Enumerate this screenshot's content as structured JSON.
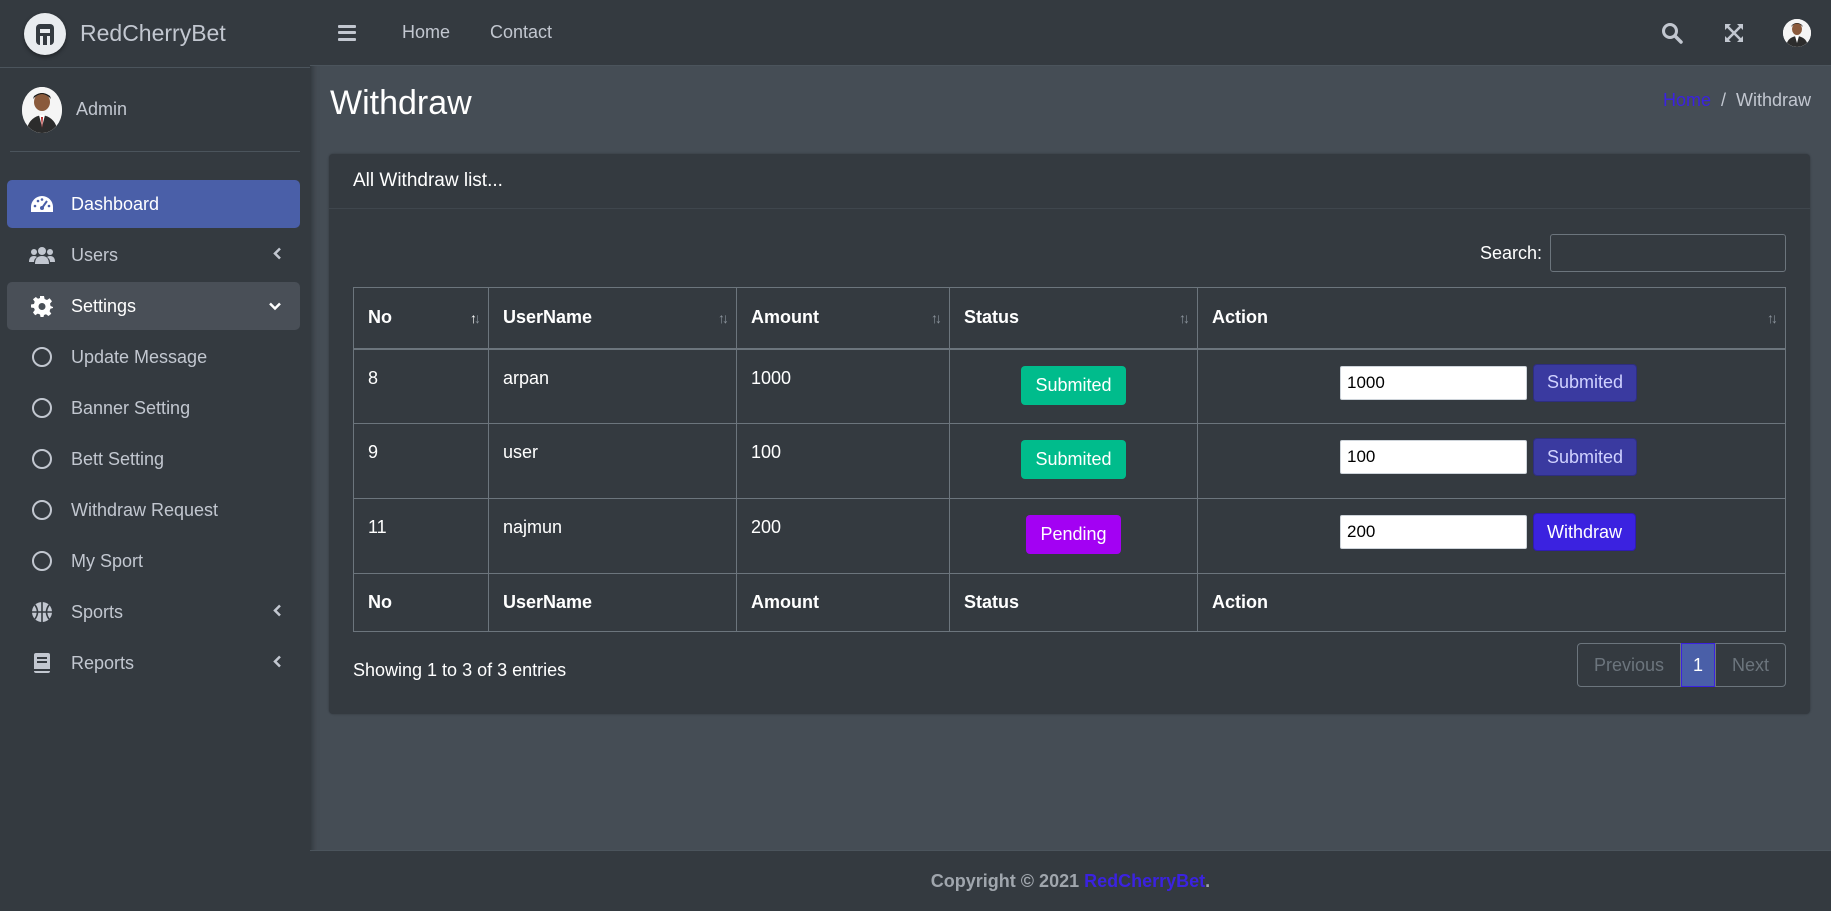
{
  "brand": {
    "name": "RedCherryBet"
  },
  "user": {
    "name": "Admin"
  },
  "sidebar": {
    "items": [
      {
        "label": "Dashboard",
        "icon": "dashboard-icon"
      },
      {
        "label": "Users",
        "icon": "users-icon"
      },
      {
        "label": "Settings",
        "icon": "gear-icon"
      },
      {
        "label": "Update Message",
        "icon": "circle-icon"
      },
      {
        "label": "Banner Setting",
        "icon": "circle-icon"
      },
      {
        "label": "Bett Setting",
        "icon": "circle-icon"
      },
      {
        "label": "Withdraw Request",
        "icon": "circle-icon"
      },
      {
        "label": "My Sport",
        "icon": "circle-icon"
      },
      {
        "label": "Sports",
        "icon": "basketball-icon"
      },
      {
        "label": "Reports",
        "icon": "book-icon"
      }
    ]
  },
  "topbar": {
    "home": "Home",
    "contact": "Contact"
  },
  "page": {
    "title": "Withdraw"
  },
  "breadcrumb": {
    "home": "Home",
    "separator": "/",
    "current": "Withdraw"
  },
  "card": {
    "title": "All Withdraw list..."
  },
  "search": {
    "label": "Search:",
    "placeholder": "",
    "value": ""
  },
  "table": {
    "headers": [
      "No",
      "UserName",
      "Amount",
      "Status",
      "Action"
    ],
    "rows": [
      {
        "no": "8",
        "username": "arpan",
        "amount": "1000",
        "status": "Submited",
        "input_value": "1000",
        "action_label": "Submited"
      },
      {
        "no": "9",
        "username": "user",
        "amount": "100",
        "status": "Submited",
        "input_value": "100",
        "action_label": "Submited"
      },
      {
        "no": "11",
        "username": "najmun",
        "amount": "200",
        "status": "Pending",
        "input_value": "200",
        "action_label": "Withdraw"
      }
    ],
    "footers": [
      "No",
      "UserName",
      "Amount",
      "Status",
      "Action"
    ]
  },
  "info": "Showing 1 to 3 of 3 entries",
  "pagination": {
    "previous": "Previous",
    "current": "1",
    "next": "Next"
  },
  "footer": {
    "text": "Copyright © 2021 ",
    "brand": "RedCherryBet",
    "suffix": "."
  },
  "colors": {
    "accent": "#4a5fa8",
    "link": "#3b22e0",
    "submitted": "#00bc8c",
    "pending": "#a301f3",
    "withdraw": "#3b22e0"
  }
}
